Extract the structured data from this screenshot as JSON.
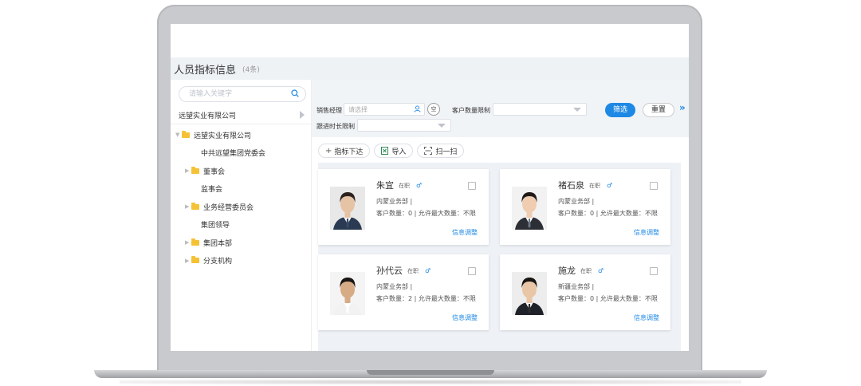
{
  "header": {
    "title": "人员指标信息",
    "count": "(4条)"
  },
  "sidebar": {
    "search_placeholder": "请输入关键字",
    "company": "远望实业有限公司",
    "tree": [
      {
        "label": "远望实业有限公司",
        "caret": "▼",
        "folder": true,
        "indent": 6
      },
      {
        "label": "中共远望集团党委会",
        "caret": "",
        "folder": false,
        "indent": 30
      },
      {
        "label": "董事会",
        "caret": "▶",
        "folder": true,
        "indent": 18
      },
      {
        "label": "监事会",
        "caret": "",
        "folder": false,
        "indent": 30
      },
      {
        "label": "业务经营委员会",
        "caret": "▶",
        "folder": true,
        "indent": 18
      },
      {
        "label": "集团领导",
        "caret": "",
        "folder": false,
        "indent": 30
      },
      {
        "label": "集团本部",
        "caret": "▶",
        "folder": true,
        "indent": 18
      },
      {
        "label": "分支机构",
        "caret": "▶",
        "folder": true,
        "indent": 18
      }
    ]
  },
  "filters": {
    "sales_manager_label": "销售经理",
    "sales_manager_placeholder": "请选择",
    "empty_label": "空",
    "customer_limit_label": "客户数量限制",
    "followup_limit_label": "跟进时长限制",
    "filter_button": "筛选",
    "reset_button": "重置",
    "expand_label": "»"
  },
  "toolbar": {
    "assign_label": "指标下达",
    "import_label": "导入",
    "scan_label": "扫一扫"
  },
  "cards": [
    {
      "name": "朱宜",
      "status": "在职",
      "gender": "♂",
      "dept": "内蒙业务部  |",
      "quota": "客户数量：0 | 允许最大数量：不限",
      "link": "信息调整",
      "colors": {
        "bg": "#e8e8e8",
        "hair": "#2b2220",
        "skin": "#e6c3a5",
        "suit": "#2a3a52",
        "shirt": "#ffffff",
        "tie": "#3a4a6b"
      }
    },
    {
      "name": "褚石泉",
      "status": "在职",
      "gender": "♂",
      "dept": "内蒙业务部  |",
      "quota": "客户数量：0 | 允许最大数量：不限",
      "link": "信息调整",
      "colors": {
        "bg": "#f2f2f2",
        "hair": "#1f1a18",
        "skin": "#f0cdb0",
        "suit": "#2d2f36",
        "shirt": "#ffffff",
        "tie": "#6d7785"
      }
    },
    {
      "name": "孙代云",
      "status": "在职",
      "gender": "♂",
      "dept": "内蒙业务部  |",
      "quota": "客户数量：2 | 允许最大数量：不限",
      "link": "信息调整",
      "colors": {
        "bg": "#f4f4f4",
        "hair": "#1a1715",
        "skin": "#d7ab86",
        "suit": "#f2f2f2",
        "shirt": "#ffffff",
        "tie": "#ffffff"
      }
    },
    {
      "name": "施龙",
      "status": "在职",
      "gender": "♂",
      "dept": "新疆业务部  |",
      "quota": "客户数量：0 | 允许最大数量：不限",
      "link": "信息调整",
      "colors": {
        "bg": "#ededed",
        "hair": "#191512",
        "skin": "#e9c6a6",
        "suit": "#1f2228",
        "shirt": "#ffffff",
        "tie": "#2f2f2f"
      }
    }
  ]
}
